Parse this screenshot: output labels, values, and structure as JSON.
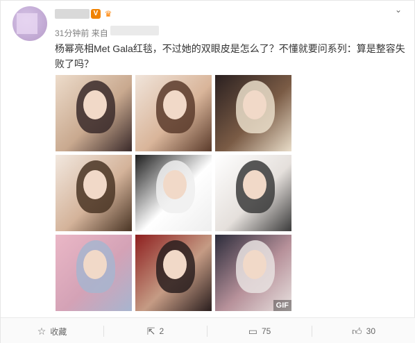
{
  "post": {
    "author_name_redacted": true,
    "meta_time": "31分钟前",
    "meta_source_label": "来自",
    "text": "杨幂亮相Met Gala红毯，不过她的双眼皮是怎么了？不懂就要问系列：算是整容失败了吗？"
  },
  "photos": [
    {
      "name": "photo-1",
      "colors": [
        "#3a2a2a",
        "#c9a98f",
        "#eddccb"
      ]
    },
    {
      "name": "photo-2",
      "colors": [
        "#5b3b2b",
        "#d9b59a",
        "#f0e4da"
      ]
    },
    {
      "name": "photo-3",
      "colors": [
        "#e9ddc9",
        "#7a5b45",
        "#2a2020"
      ]
    },
    {
      "name": "photo-4",
      "colors": [
        "#4a3525",
        "#d4b39a",
        "#f2e8df"
      ]
    },
    {
      "name": "photo-5",
      "colors": [
        "#eeeeee",
        "#ffffff",
        "#1d1d1d"
      ]
    },
    {
      "name": "photo-6",
      "colors": [
        "#3b3b3b",
        "#e5e0dc",
        "#ffffff"
      ]
    },
    {
      "name": "photo-7",
      "colors": [
        "#a7b5cf",
        "#d4a2b6",
        "#eab7c6"
      ]
    },
    {
      "name": "photo-8",
      "colors": [
        "#2a1e1e",
        "#c59b84",
        "#8e1f1f"
      ]
    },
    {
      "name": "photo-9",
      "colors": [
        "#e8e2e0",
        "#b7919a",
        "#2b2b3a"
      ]
    }
  ],
  "gif_label": "GIF",
  "actions": {
    "favorite_label": "收藏",
    "share_count": "2",
    "comment_count": "75",
    "like_count": "30"
  },
  "icons": {
    "favorite": "star-icon",
    "share": "share-icon",
    "comment": "comment-icon",
    "like": "thumbs-up-icon",
    "menu": "chevron-down-icon"
  }
}
